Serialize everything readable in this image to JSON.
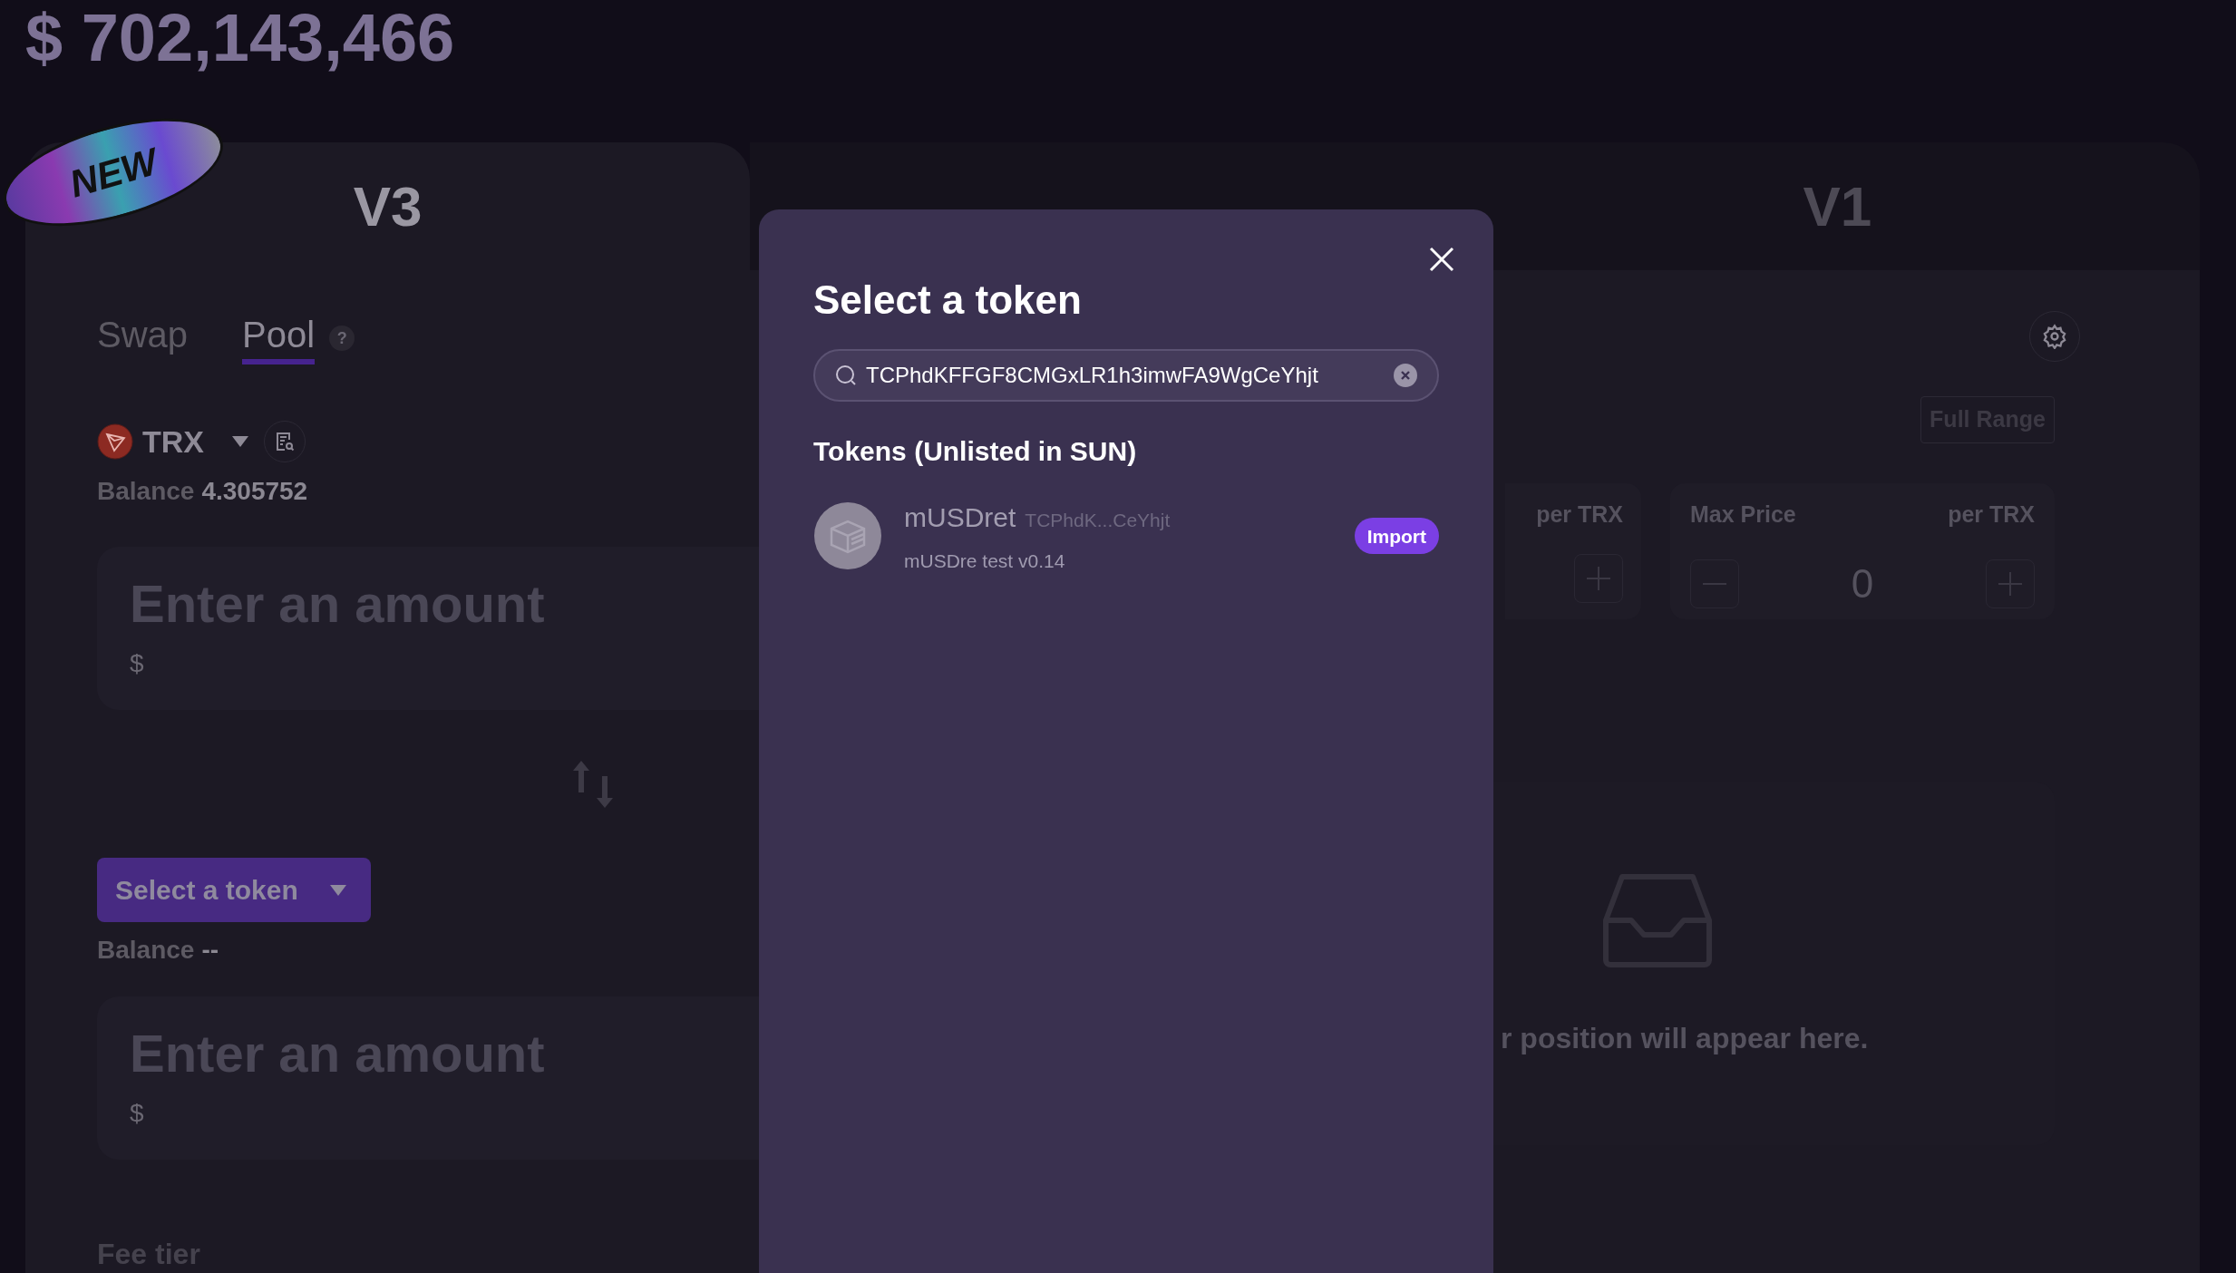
{
  "header": {
    "tvl": "$ 702,143,466"
  },
  "badge": {
    "text": "NEW"
  },
  "versions": [
    {
      "label": "V3",
      "selected": true
    },
    {
      "label": "V1",
      "selected": false
    }
  ],
  "mode_tabs": [
    {
      "label": "Swap",
      "selected": false
    },
    {
      "label": "Pool",
      "selected": true
    }
  ],
  "help_mark": "?",
  "token_a": {
    "symbol": "TRX",
    "balance_label": "Balance",
    "balance": "4.305752",
    "amount_placeholder": "Enter an amount",
    "usd": "$"
  },
  "token_b": {
    "button": "Select a token",
    "balance_label": "Balance",
    "balance": "--",
    "amount_placeholder": "Enter an amount",
    "usd": "$"
  },
  "fee_tier_label": "Fee tier",
  "range": {
    "full_range": "Full Range",
    "min_unit": "per TRX",
    "max_label": "Max Price",
    "max_value": "0",
    "max_unit": "per TRX"
  },
  "empty_state": "r position will appear here.",
  "modal": {
    "title": "Select a token",
    "search_value": "TCPhdKFFGF8CMGxLR1h3imwFA9WgCeYhjt",
    "section": "Tokens (Unlisted in SUN)",
    "tokens": [
      {
        "name": "mUSDret",
        "address": "TCPhdK...CeYhjt",
        "description": "mUSDre test v0.14",
        "action": "Import"
      }
    ]
  }
}
